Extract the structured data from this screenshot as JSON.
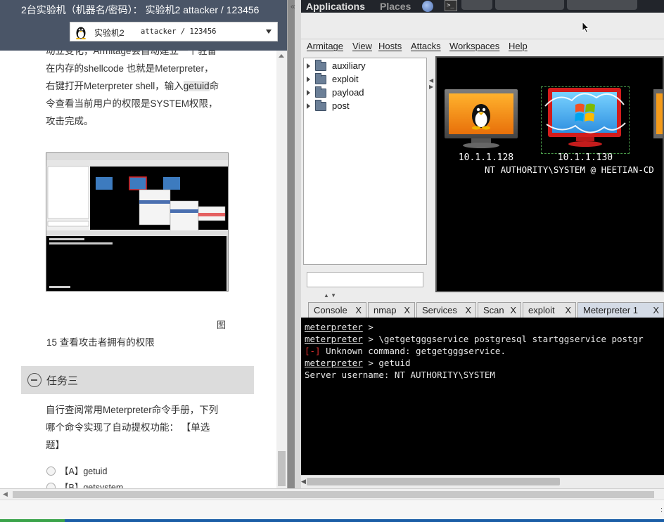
{
  "lab_panel": {
    "header_title": "2台实验机（机器名/密码）：  实验机2    attacker / 123456",
    "machine_select": {
      "label": "实验机2",
      "credentials": "attacker / 123456"
    },
    "paragraph_top_fragment": "动立变化，Armitage会自动建立一个驻留",
    "paragraph_lines": [
      "在内存的shellcode 也就是Meterpreter，",
      "右键打开Meterpreter shell，输入",
      "令查看当前用户的权限是SYSTEM权限，",
      "攻击完成。"
    ],
    "paragraph_highlight": "getuid",
    "paragraph_line2_tail": "命",
    "figure_label": "图",
    "figure_caption": "15 查看攻击者拥有的权限",
    "task_title": "任务三",
    "question_lines": [
      "自行查阅常用Meterpreter命令手册，下列",
      "哪个命令实现了自动提权功能：  【单选",
      "题】"
    ],
    "options": [
      "【A】getuid",
      "【B】getsystem"
    ]
  },
  "gnome_panel": {
    "applications": "Applications",
    "places": "Places",
    "terminal_glyph": ">_"
  },
  "armitage": {
    "menus": [
      "Armitage",
      "View",
      "Hosts",
      "Attacks",
      "Workspaces",
      "Help"
    ],
    "module_tree": [
      "auxiliary",
      "exploit",
      "payload",
      "post"
    ],
    "hosts": [
      {
        "ip": "10.1.1.128",
        "os": "linux"
      },
      {
        "ip": "10.1.1.130",
        "os": "windows"
      }
    ],
    "session_label": "NT AUTHORITY\\SYSTEM @ HEETIAN-CD",
    "tabs": [
      "Console",
      "nmap",
      "Services",
      "Scan",
      "exploit",
      "Meterpreter 1"
    ],
    "tab_close": "X",
    "active_tab": "Meterpreter 1",
    "console_lines": [
      {
        "prompt": "meterpreter",
        "text": " >"
      },
      {
        "prompt": "meterpreter",
        "text": " > \\getgetgggservice postgresql startggservice postgr"
      },
      {
        "error_tag": "[-]",
        "text": " Unknown command: getgetgggservice."
      },
      {
        "prompt": "meterpreter",
        "text": " > getuid"
      },
      {
        "plain": "Server username: NT AUTHORITY\\SYSTEM"
      }
    ]
  },
  "colors": {
    "header_bg": "#4a5567",
    "console_bg": "#000000",
    "error": "#e03030",
    "active_tab": "#d4dbe6"
  }
}
